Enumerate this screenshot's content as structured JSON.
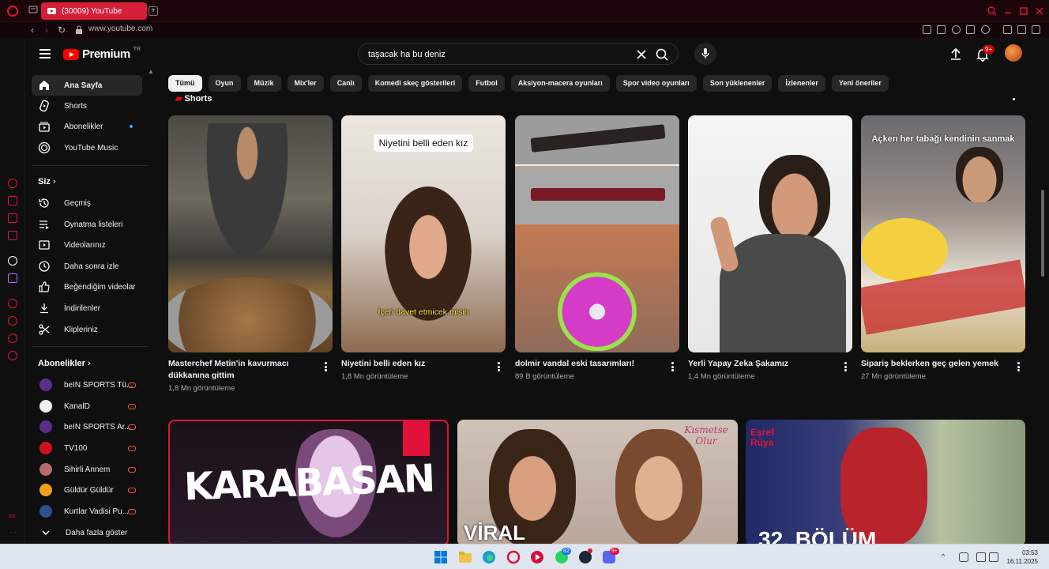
{
  "browser": {
    "tab_title": "(30009) YouTube",
    "url": "www.youtube.com"
  },
  "header": {
    "logo_text": "Premium",
    "logo_region": "TR",
    "search_value": "taşacak ha bu deniz",
    "notifications_badge": "9+"
  },
  "sidebar": {
    "main_items": [
      {
        "label": "Ana Sayfa",
        "icon": "home-icon",
        "active": true
      },
      {
        "label": "Shorts",
        "icon": "shorts-icon"
      },
      {
        "label": "Abonelikler",
        "icon": "subscriptions-icon",
        "dot": true
      },
      {
        "label": "YouTube Music",
        "icon": "music-icon"
      }
    ],
    "you_heading": "Siz",
    "you_items": [
      {
        "label": "Geçmiş",
        "icon": "history-icon"
      },
      {
        "label": "Oynatma listeleri",
        "icon": "playlist-icon"
      },
      {
        "label": "Videolarınız",
        "icon": "your-videos-icon"
      },
      {
        "label": "Daha sonra izle",
        "icon": "watch-later-icon"
      },
      {
        "label": "Beğendiğim videolar",
        "icon": "like-icon"
      },
      {
        "label": "İndirilenler",
        "icon": "download-icon"
      },
      {
        "label": "Klipleriniz",
        "icon": "scissors-icon"
      }
    ],
    "subs_heading": "Abonelikler",
    "subscriptions": [
      {
        "name": "beIN SPORTS Tü...",
        "color": "#5b2d8a"
      },
      {
        "name": "KanalD",
        "color": "#eeeeee"
      },
      {
        "name": "beIN SPORTS Ar...",
        "color": "#5b2d8a"
      },
      {
        "name": "TV100",
        "color": "#d3101f"
      },
      {
        "name": "Sihirli Annem",
        "color": "#b86b6b"
      },
      {
        "name": "Güldür Güldür",
        "color": "#f0a21a"
      },
      {
        "name": "Kurtlar Vadisi Pu...",
        "color": "#2b4f8f"
      }
    ],
    "show_more": "Daha fazla göster"
  },
  "chips": [
    "Tümü",
    "Oyun",
    "Müzik",
    "Mix'ler",
    "Canlı",
    "Komedi skeç gösterileri",
    "Futbol",
    "Aksiyon-macera oyunları",
    "Spor video oyunları",
    "Son yüklenenler",
    "İzlenenler",
    "Yeni öneriler"
  ],
  "shorts_heading": "Shorts",
  "shorts": [
    {
      "title": "Masterchef Metin'in kavurmacı dükkanına gittim",
      "views": "1,8 Mn görüntüleme"
    },
    {
      "title": "Niyetini belli eden kız",
      "views": "1,8 Mn görüntüleme",
      "caption_top": "Niyetini belli eden kız",
      "caption_bottom": "İçeri davet etmicek misin"
    },
    {
      "title": "dolmir vandal eski tasarımları!",
      "views": "89 B görüntüleme"
    },
    {
      "title": "Yerli Yapay Zeka Şakamız",
      "views": "1,4 Mn görüntüleme"
    },
    {
      "title": "Sipariş beklerken geç gelen yemek",
      "views": "27 Mn görüntüleme",
      "caption_top": "Açken her tabağı kendinin sanmak"
    }
  ],
  "videos": [
    {
      "thumb_text": "KARABASAN"
    },
    {
      "thumb_text": "VİRAL",
      "logo_text": "Kısmetse Olur"
    },
    {
      "thumb_text": "32. BÖLÜM",
      "logo_text": "Eşref Rüya"
    }
  ],
  "taskbar": {
    "time": "03:53",
    "date": "16.11.2025",
    "whatsapp_badge": "82",
    "discord_badge": "9+"
  }
}
